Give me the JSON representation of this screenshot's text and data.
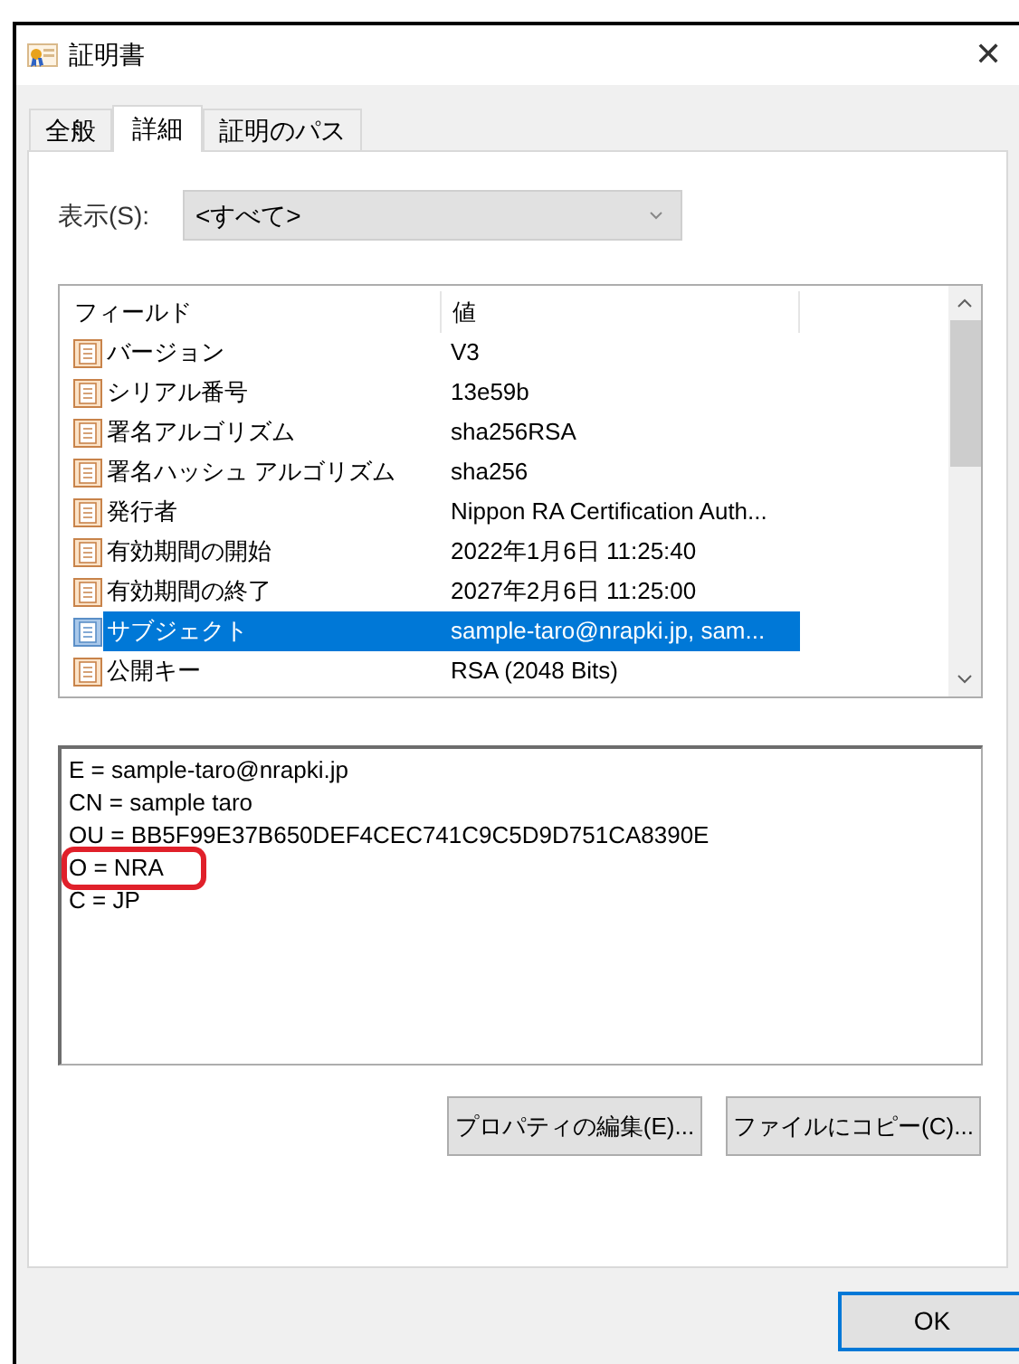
{
  "window": {
    "title": "証明書",
    "close": "✕"
  },
  "tabs": [
    {
      "label": "全般",
      "selected": false
    },
    {
      "label": "詳細",
      "selected": true
    },
    {
      "label": "証明のパス",
      "selected": false
    }
  ],
  "show": {
    "label": "表示(S):",
    "value": "<すべて>"
  },
  "table": {
    "columns": [
      "フィールド",
      "値"
    ],
    "rows": [
      {
        "field": "バージョン",
        "value": "V3",
        "selected": false
      },
      {
        "field": "シリアル番号",
        "value": "13e59b",
        "selected": false
      },
      {
        "field": "署名アルゴリズム",
        "value": "sha256RSA",
        "selected": false
      },
      {
        "field": "署名ハッシュ アルゴリズム",
        "value": "sha256",
        "selected": false
      },
      {
        "field": "発行者",
        "value": "Nippon RA Certification Auth...",
        "selected": false
      },
      {
        "field": "有効期間の開始",
        "value": "2022年1月6日 11:25:40",
        "selected": false
      },
      {
        "field": "有効期間の終了",
        "value": "2027年2月6日 11:25:00",
        "selected": false
      },
      {
        "field": "サブジェクト",
        "value": "sample-taro@nrapki.jp, sam...",
        "selected": true
      },
      {
        "field": "公開キー",
        "value": "RSA (2048 Bits)",
        "selected": false
      }
    ]
  },
  "details": [
    {
      "text": "E = sample-taro@nrapki.jp",
      "highlighted": false
    },
    {
      "text": "CN = sample taro",
      "highlighted": false
    },
    {
      "text": "OU = BB5F99E37B650DEF4CEC741C9C5D9D751CA8390E",
      "highlighted": false
    },
    {
      "text": "O = NRA",
      "highlighted": true
    },
    {
      "text": "C = JP",
      "highlighted": false
    }
  ],
  "buttons": [
    "プロパティの編集(E)...",
    "ファイルにコピー(C)..."
  ],
  "ok": "OK"
}
